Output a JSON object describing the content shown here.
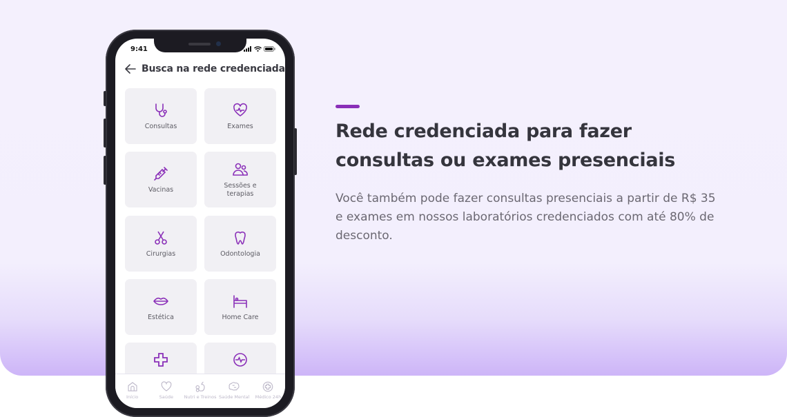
{
  "colors": {
    "accent": "#8a2fb8",
    "icon": "#8a2fb8",
    "nav_inactive": "#bdb8c9"
  },
  "hero": {
    "headline_line1": "Rede credenciada para fazer",
    "headline_line2": "consultas ou exames presenciais",
    "description": "Você também pode fazer consultas presenciais a partir de R$ 35 e exames em nossos laboratórios credenciados com até 80% de desconto."
  },
  "phone": {
    "status_time": "9:41",
    "header": {
      "back_icon": "arrow-left-icon",
      "title": "Busca na rede credenciada"
    },
    "tiles": [
      {
        "label": "Consultas",
        "icon": "stethoscope-icon"
      },
      {
        "label": "Exames",
        "icon": "heart-pulse-icon"
      },
      {
        "label": "Vacinas",
        "icon": "syringe-icon"
      },
      {
        "label": "Sessões e terapias",
        "icon": "people-icon"
      },
      {
        "label": "Cirurgias",
        "icon": "scissors-icon"
      },
      {
        "label": "Odontologia",
        "icon": "tooth-icon"
      },
      {
        "label": "Estética",
        "icon": "lips-icon"
      },
      {
        "label": "Home Care",
        "icon": "bed-icon"
      },
      {
        "label": "",
        "icon": "plus-cross-icon"
      },
      {
        "label": "",
        "icon": "pulse-circle-icon"
      }
    ],
    "nav": [
      {
        "label": "Início",
        "icon": "home-icon"
      },
      {
        "label": "Saúde",
        "icon": "heart-icon"
      },
      {
        "label": "Nutri e Treinos",
        "icon": "apple-dumbbell-icon"
      },
      {
        "label": "Saúde Mental",
        "icon": "brain-icon"
      },
      {
        "label": "Médico 24h",
        "icon": "plus-circle-icon"
      }
    ]
  }
}
